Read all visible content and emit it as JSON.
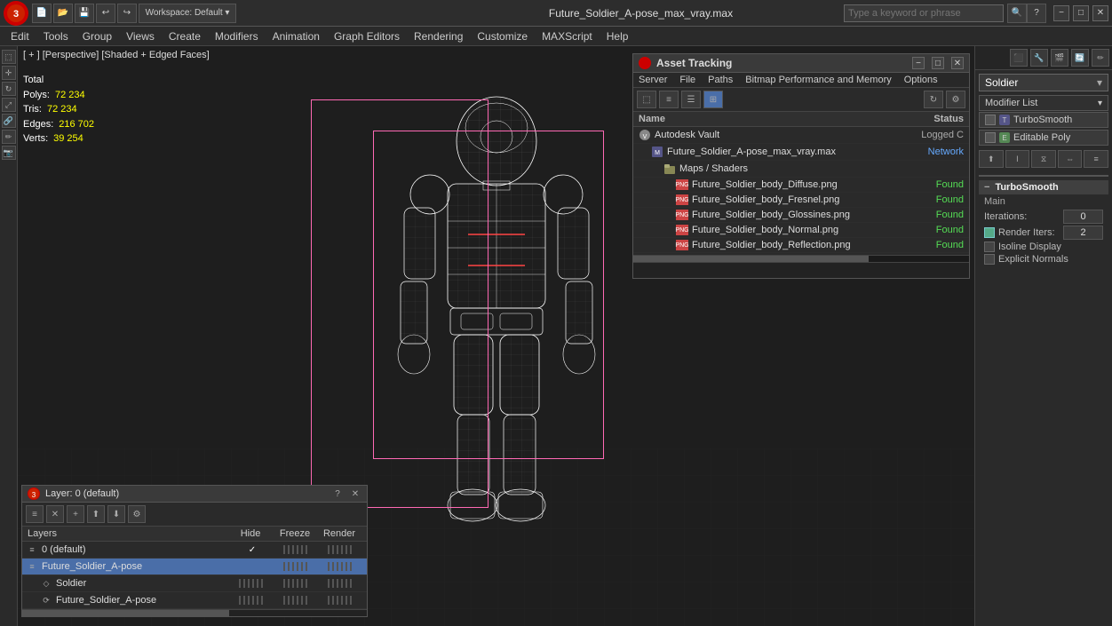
{
  "titlebar": {
    "logo": "3",
    "filename": "Future_Soldier_A-pose_max_vray.max",
    "search_placeholder": "Type a keyword or phrase",
    "minimize": "−",
    "maximize": "□",
    "close": "✕"
  },
  "menubar": {
    "items": [
      "Edit",
      "Tools",
      "Group",
      "Views",
      "Create",
      "Modifiers",
      "Animation",
      "Graph Editors",
      "Rendering",
      "Customize",
      "MAXScript",
      "Help"
    ]
  },
  "viewport": {
    "label": "[ + ] [Perspective] [Shaded + Edged Faces]",
    "stats": {
      "header": "Total",
      "polys_label": "Polys:",
      "polys_value": "72 234",
      "tris_label": "Tris:",
      "tris_value": "72 234",
      "edges_label": "Edges:",
      "edges_value": "216 702",
      "verts_label": "Verts:",
      "verts_value": "39 254"
    }
  },
  "right_panel": {
    "object_name": "Soldier",
    "modifier_list_label": "Modifier List",
    "modifiers": [
      {
        "name": "TurboSmooth",
        "active": false
      },
      {
        "name": "Editable Poly",
        "active": false
      }
    ],
    "section_title": "TurboSmooth",
    "main_label": "Main",
    "iterations_label": "Iterations:",
    "iterations_value": "0",
    "render_iters_label": "Render Iters:",
    "render_iters_value": "2",
    "isoline_label": "Isoline Display",
    "explicit_label": "Explicit Normals"
  },
  "layers_panel": {
    "title": "Layer: 0 (default)",
    "columns": {
      "name": "Layers",
      "hide": "Hide",
      "freeze": "Freeze",
      "render": "Render"
    },
    "rows": [
      {
        "indent": 0,
        "icon": "≡",
        "name": "0 (default)",
        "hide": true,
        "selected": false
      },
      {
        "indent": 0,
        "icon": "≡",
        "name": "Future_Soldier_A-pose",
        "hide": false,
        "selected": true
      },
      {
        "indent": 1,
        "icon": "◇",
        "name": "Soldier",
        "hide": false,
        "selected": false
      },
      {
        "indent": 1,
        "icon": "⟳",
        "name": "Future_Soldier_A-pose",
        "hide": false,
        "selected": false
      }
    ]
  },
  "asset_panel": {
    "title": "Asset Tracking",
    "menu": [
      "Server",
      "File",
      "Paths",
      "Bitmap Performance and Memory",
      "Options"
    ],
    "table_header": {
      "name": "Name",
      "status": "Status"
    },
    "rows": [
      {
        "indent": 0,
        "icon": "vault",
        "name": "Autodesk Vault",
        "status": "Logged C",
        "status_class": "status-logged"
      },
      {
        "indent": 1,
        "icon": "file",
        "name": "Future_Soldier_A-pose_max_vray.max",
        "status": "Network",
        "status_class": "status-network"
      },
      {
        "indent": 2,
        "icon": "folder",
        "name": "Maps / Shaders",
        "status": "",
        "status_class": ""
      },
      {
        "indent": 3,
        "icon": "png",
        "name": "Future_Soldier_body_Diffuse.png",
        "status": "Found",
        "status_class": "status-found"
      },
      {
        "indent": 3,
        "icon": "png",
        "name": "Future_Soldier_body_Fresnel.png",
        "status": "Found",
        "status_class": "status-found"
      },
      {
        "indent": 3,
        "icon": "png",
        "name": "Future_Soldier_body_Glossines.png",
        "status": "Found",
        "status_class": "status-found"
      },
      {
        "indent": 3,
        "icon": "png",
        "name": "Future_Soldier_body_Normal.png",
        "status": "Found",
        "status_class": "status-found"
      },
      {
        "indent": 3,
        "icon": "png",
        "name": "Future_Soldier_body_Reflection.png",
        "status": "Found",
        "status_class": "status-found"
      }
    ]
  }
}
